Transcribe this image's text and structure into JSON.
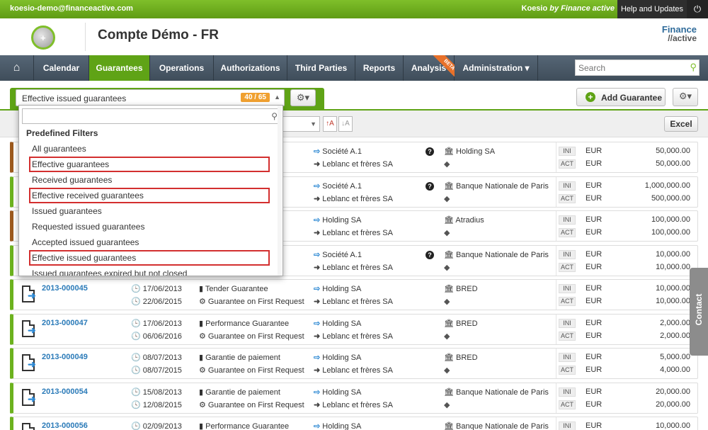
{
  "topbar": {
    "email": "koesio-demo@financeactive.com",
    "brand_main": "Koesio",
    "brand_by": "by Finance active",
    "help": "Help and Updates",
    "power_icon": "power-icon"
  },
  "header": {
    "title": "Compte Démo - FR",
    "logo_line1": "Finance",
    "logo_line2": "//active"
  },
  "nav": {
    "items": [
      "Calendar",
      "Guarantees",
      "Operations",
      "Authorizations",
      "Third Parties",
      "Reports",
      "Analysis",
      "Administration ▾"
    ],
    "active": "Guarantees",
    "beta": "BETA",
    "search_placeholder": "Search"
  },
  "filter": {
    "selected": "Effective issued guarantees",
    "count": "40 / 65"
  },
  "actions": {
    "add": "Add Guarantee",
    "excel": "Excel"
  },
  "dropdown": {
    "header": "Predefined Filters",
    "options": [
      {
        "label": "All guarantees",
        "highlight": false
      },
      {
        "label": "Effective guarantees",
        "highlight": true
      },
      {
        "label": "Received guarantees",
        "highlight": false
      },
      {
        "label": "Effective received guarantees",
        "highlight": true
      },
      {
        "label": "Issued guarantees",
        "highlight": false
      },
      {
        "label": "Requested issued guarantees",
        "highlight": false
      },
      {
        "label": "Accepted issued guarantees",
        "highlight": false
      },
      {
        "label": "Effective issued guarantees",
        "highlight": true
      },
      {
        "label": "Issued guarantees expired but not closed",
        "highlight": false
      }
    ]
  },
  "rows": [
    {
      "color": "brown",
      "ref": "",
      "d1": "",
      "d2": "",
      "t1": "e",
      "t2": "equest",
      "p1": "Société A.1",
      "p2": "Leblanc et frères SA",
      "q": true,
      "bank": "Holding SA",
      "cur": [
        "EUR",
        "EUR"
      ],
      "amt": [
        "50,000.00",
        "50,000.00"
      ]
    },
    {
      "color": "green",
      "ref": "",
      "d1": "",
      "d2": "",
      "t1": "e",
      "t2": "equest",
      "p1": "Société A.1",
      "p2": "Leblanc et frères SA",
      "q": true,
      "bank": "Banque Nationale de Paris",
      "cur": [
        "EUR",
        "EUR"
      ],
      "amt": [
        "1,000,000.00",
        "500,000.00"
      ]
    },
    {
      "color": "brown",
      "ref": "",
      "d1": "",
      "d2": "",
      "t1": "",
      "t2": "equest",
      "p1": "Holding SA",
      "p2": "Leblanc et frères SA",
      "q": false,
      "bank": "Atradius",
      "cur": [
        "EUR",
        "EUR"
      ],
      "amt": [
        "100,000.00",
        "100,000.00"
      ]
    },
    {
      "color": "green",
      "ref": "",
      "d1": "",
      "d2": "",
      "t1": "e",
      "t2": "equest",
      "p1": "Société A.1",
      "p2": "Leblanc et frères SA",
      "q": true,
      "bank": "Banque Nationale de Paris",
      "cur": [
        "EUR",
        "EUR"
      ],
      "amt": [
        "10,000.00",
        "10,000.00"
      ]
    },
    {
      "color": "green",
      "ref": "2013-000045",
      "d1": "17/06/2013",
      "d2": "22/06/2015",
      "t1": "Tender Guarantee",
      "t2": "Guarantee on First Request",
      "p1": "Holding SA",
      "p2": "Leblanc et frères SA",
      "q": false,
      "bank": "BRED",
      "cur": [
        "EUR",
        "EUR"
      ],
      "amt": [
        "10,000.00",
        "10,000.00"
      ]
    },
    {
      "color": "green",
      "ref": "2013-000047",
      "d1": "17/06/2013",
      "d2": "06/06/2016",
      "t1": "Performance Guarantee",
      "t2": "Guarantee on First Request",
      "p1": "Holding SA",
      "p2": "Leblanc et frères SA",
      "q": false,
      "bank": "BRED",
      "cur": [
        "EUR",
        "EUR"
      ],
      "amt": [
        "2,000.00",
        "2,000.00"
      ]
    },
    {
      "color": "green",
      "ref": "2013-000049",
      "d1": "08/07/2013",
      "d2": "08/07/2015",
      "t1": "Garantie de paiement",
      "t2": "Guarantee on First Request",
      "p1": "Holding SA",
      "p2": "Leblanc et frères SA",
      "q": false,
      "bank": "BRED",
      "cur": [
        "EUR",
        "EUR"
      ],
      "amt": [
        "5,000.00",
        "4,000.00"
      ]
    },
    {
      "color": "green",
      "ref": "2013-000054",
      "d1": "15/08/2013",
      "d2": "12/08/2015",
      "t1": "Garantie de paiement",
      "t2": "Guarantee on First Request",
      "p1": "Holding SA",
      "p2": "Leblanc et frères SA",
      "q": false,
      "bank": "Banque Nationale de Paris",
      "cur": [
        "EUR",
        "EUR"
      ],
      "amt": [
        "20,000.00",
        "20,000.00"
      ]
    },
    {
      "color": "green",
      "ref": "2013-000056",
      "d1": "02/09/2013",
      "d2": "",
      "t1": "Performance Guarantee",
      "t2": "",
      "p1": "Holding SA",
      "p2": "",
      "q": false,
      "bank": "Banque Nationale de Paris",
      "cur": [
        "EUR",
        ""
      ],
      "amt": [
        "10,000.00",
        ""
      ]
    }
  ],
  "labels": {
    "ini": "INI",
    "act": "ACT"
  },
  "contact": "Contact"
}
